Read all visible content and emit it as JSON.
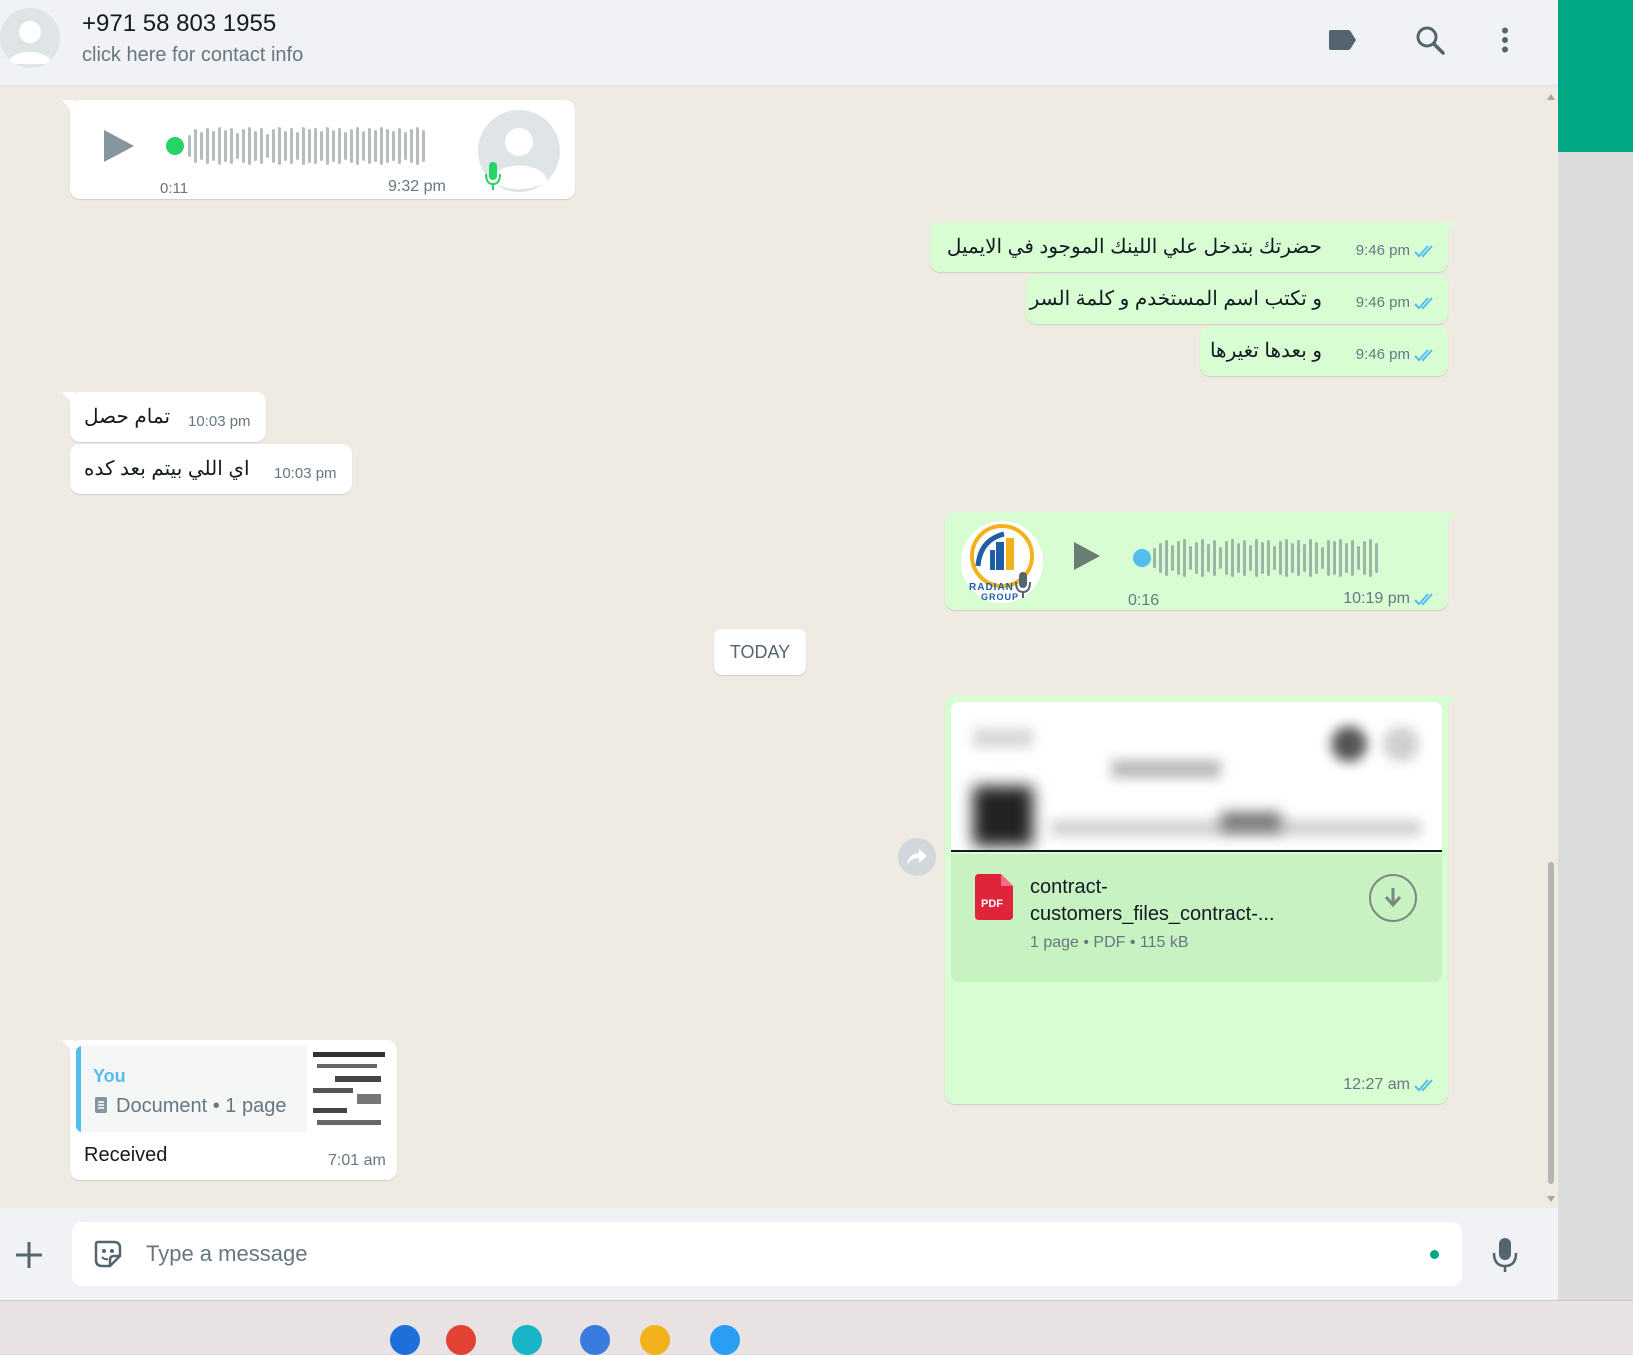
{
  "header": {
    "contact_name": "+971 58 803 1955",
    "contact_subtitle": "click here for contact info",
    "label_icon": "label-icon",
    "search_icon": "search-icon",
    "menu_icon": "kebab-menu-icon"
  },
  "messages": {
    "voice_in": {
      "duration": "0:11",
      "time": "9:32 pm"
    },
    "out1": {
      "text": "حضرتك بتدخل علي اللينك الموجود في الايميل",
      "time": "9:46 pm"
    },
    "out2": {
      "text": "و تكتب اسم المستخدم و كلمة السر",
      "time": "9:46 pm"
    },
    "out3": {
      "text": "و بعدها تغيرها",
      "time": "9:46 pm"
    },
    "in1": {
      "text": "تمام حصل",
      "time": "10:03 pm"
    },
    "in2": {
      "text": "اي اللي بيتم بعد كده",
      "time": "10:03 pm"
    },
    "voice_out": {
      "duration": "0:16",
      "time": "10:19 pm",
      "avatar_text_1": "RADIAN",
      "avatar_text_2": "GROUP"
    },
    "date_chip": "TODAY",
    "doc_out": {
      "name_line1": "contract-",
      "name_line2": "customers_files_contract-...",
      "badge": "PDF",
      "meta": "1 page • PDF • 115 kB",
      "time": "12:27 am"
    },
    "reply_in": {
      "quoted_author": "You",
      "quoted_text": "Document • 1 page",
      "text": "Received",
      "time": "7:01 am"
    }
  },
  "composer": {
    "placeholder": "Type a message"
  },
  "colors": {
    "accent": "#00a884",
    "outgoing_bubble": "#d9fdd3",
    "read_ticks": "#53bdeb",
    "chat_bg": "#efeae2"
  }
}
